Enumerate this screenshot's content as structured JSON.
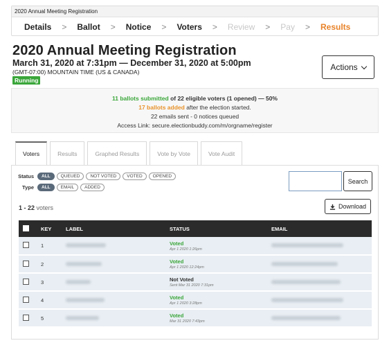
{
  "wizard": {
    "title": "2020 Annual Meeting Registration",
    "steps": [
      {
        "label": "Details",
        "state": "normal"
      },
      {
        "label": "Ballot",
        "state": "normal"
      },
      {
        "label": "Notice",
        "state": "normal"
      },
      {
        "label": "Voters",
        "state": "normal"
      },
      {
        "label": "Review",
        "state": "disabled"
      },
      {
        "label": "Pay",
        "state": "disabled"
      },
      {
        "label": "Results",
        "state": "current"
      }
    ],
    "separator": ">"
  },
  "header": {
    "title": "2020 Annual Meeting Registration",
    "dates": "March 31, 2020 at 7:31pm — December 31, 2020 at 5:00pm",
    "timezone": "(GMT-07:00) MOUNTAIN TIME (US & CANADA)",
    "status": "Running",
    "actions_label": "Actions"
  },
  "summary": {
    "submitted_strong": "11 ballots submitted",
    "submitted_rest": " of 22 eligible voters (1 opened) — 50%",
    "added_strong": "17 ballots added",
    "added_rest": " after the election started.",
    "emails": "22 emails sent - 0 notices queued",
    "access_link": "Access Link: secure.electionbuddy.com/m/orgname/register"
  },
  "tabs": [
    "Voters",
    "Results",
    "Graphed Results",
    "Vote by Vote",
    "Vote Audit"
  ],
  "filters": {
    "status_label": "Status",
    "status_options": [
      "ALL",
      "QUEUED",
      "NOT VOTED",
      "VOTED",
      "OPENED"
    ],
    "type_label": "Type",
    "type_options": [
      "ALL",
      "EMAIL",
      "ADDED"
    ]
  },
  "search": {
    "placeholder": "",
    "button": "Search"
  },
  "count": {
    "range": "1 - 22",
    "suffix": " voters"
  },
  "download_label": "Download",
  "table": {
    "columns": [
      "KEY",
      "LABEL",
      "STATUS",
      "EMAIL"
    ],
    "rows": [
      {
        "key": "1",
        "status": "Voted",
        "status_type": "voted",
        "sub": "Apr 1 2020 1:26pm"
      },
      {
        "key": "2",
        "status": "Voted",
        "status_type": "voted",
        "sub": "Apr 1 2020 12:24pm"
      },
      {
        "key": "3",
        "status": "Not Voted",
        "status_type": "notvoted",
        "sub": "Sent Mar 31 2020 7:31pm"
      },
      {
        "key": "4",
        "status": "Voted",
        "status_type": "voted",
        "sub": "Apr 1 2020 3:28pm"
      },
      {
        "key": "5",
        "status": "Voted",
        "status_type": "voted",
        "sub": "Mar 31 2020 7:43pm"
      }
    ]
  },
  "colors": {
    "accent_orange": "#e8832a",
    "running_green": "#3aa63a",
    "table_header": "#2b2b2b",
    "row_bg": "#e8eef3"
  }
}
